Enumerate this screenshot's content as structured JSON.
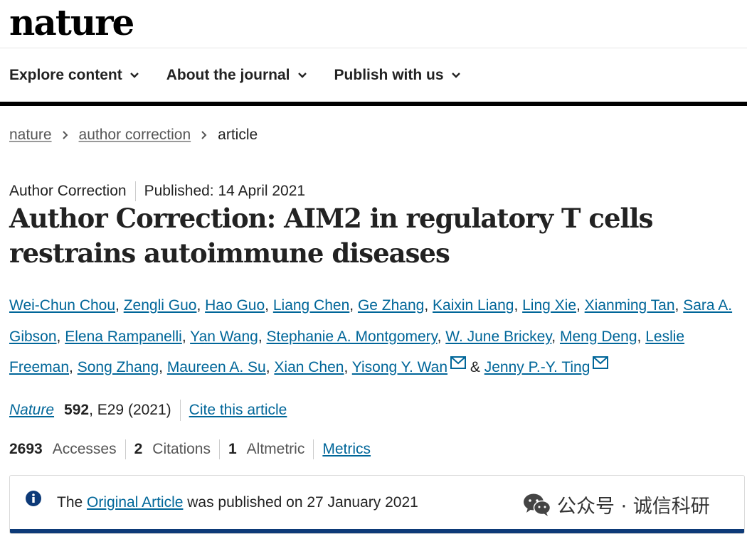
{
  "brand": {
    "logo_text": "nature"
  },
  "nav": {
    "items": [
      {
        "label": "Explore content"
      },
      {
        "label": "About the journal"
      },
      {
        "label": "Publish with us"
      }
    ]
  },
  "breadcrumb": {
    "items": [
      "nature",
      "author correction"
    ],
    "current": "article"
  },
  "article": {
    "type": "Author Correction",
    "published": "Published: 14 April 2021",
    "title": "Author Correction: AIM2 in regulatory T cells restrains autoimmune diseases",
    "authors": [
      "Wei-Chun Chou",
      "Zengli Guo",
      "Hao Guo",
      "Liang Chen",
      "Ge Zhang",
      "Kaixin Liang",
      "Ling Xie",
      "Xianming Tan",
      "Sara A. Gibson",
      "Elena Rampanelli",
      "Yan Wang",
      "Stephanie A. Montgomery",
      "W. June Brickey",
      "Meng Deng",
      "Leslie Freeman",
      "Song Zhang",
      "Maureen A. Su",
      "Xian Chen",
      "Yisong Y. Wan",
      "Jenny P.-Y. Ting"
    ],
    "author_separator": ", ",
    "last_joiner": " & ",
    "corresponding_icon": "envelope-icon"
  },
  "citation": {
    "journal": "Nature",
    "volume": "592",
    "pages": ", E29 (2021)",
    "cite_label": "Cite this article"
  },
  "metrics": {
    "accesses_count": "2693",
    "accesses_label": "Accesses",
    "citations_count": "2",
    "citations_label": "Citations",
    "altmetric_count": "1",
    "altmetric_label": "Altmetric",
    "metrics_link": "Metrics"
  },
  "notice": {
    "icon": "info-icon",
    "prefix": "The ",
    "link": "Original Article",
    "suffix": " was published on 27 January 2021"
  },
  "watermark": {
    "text": "公众号 · 诚信科研",
    "icon": "wechat-icon"
  },
  "colors": {
    "link": "#006699",
    "notice_bar": "#0d3a78",
    "nav_bar": "#000000"
  }
}
